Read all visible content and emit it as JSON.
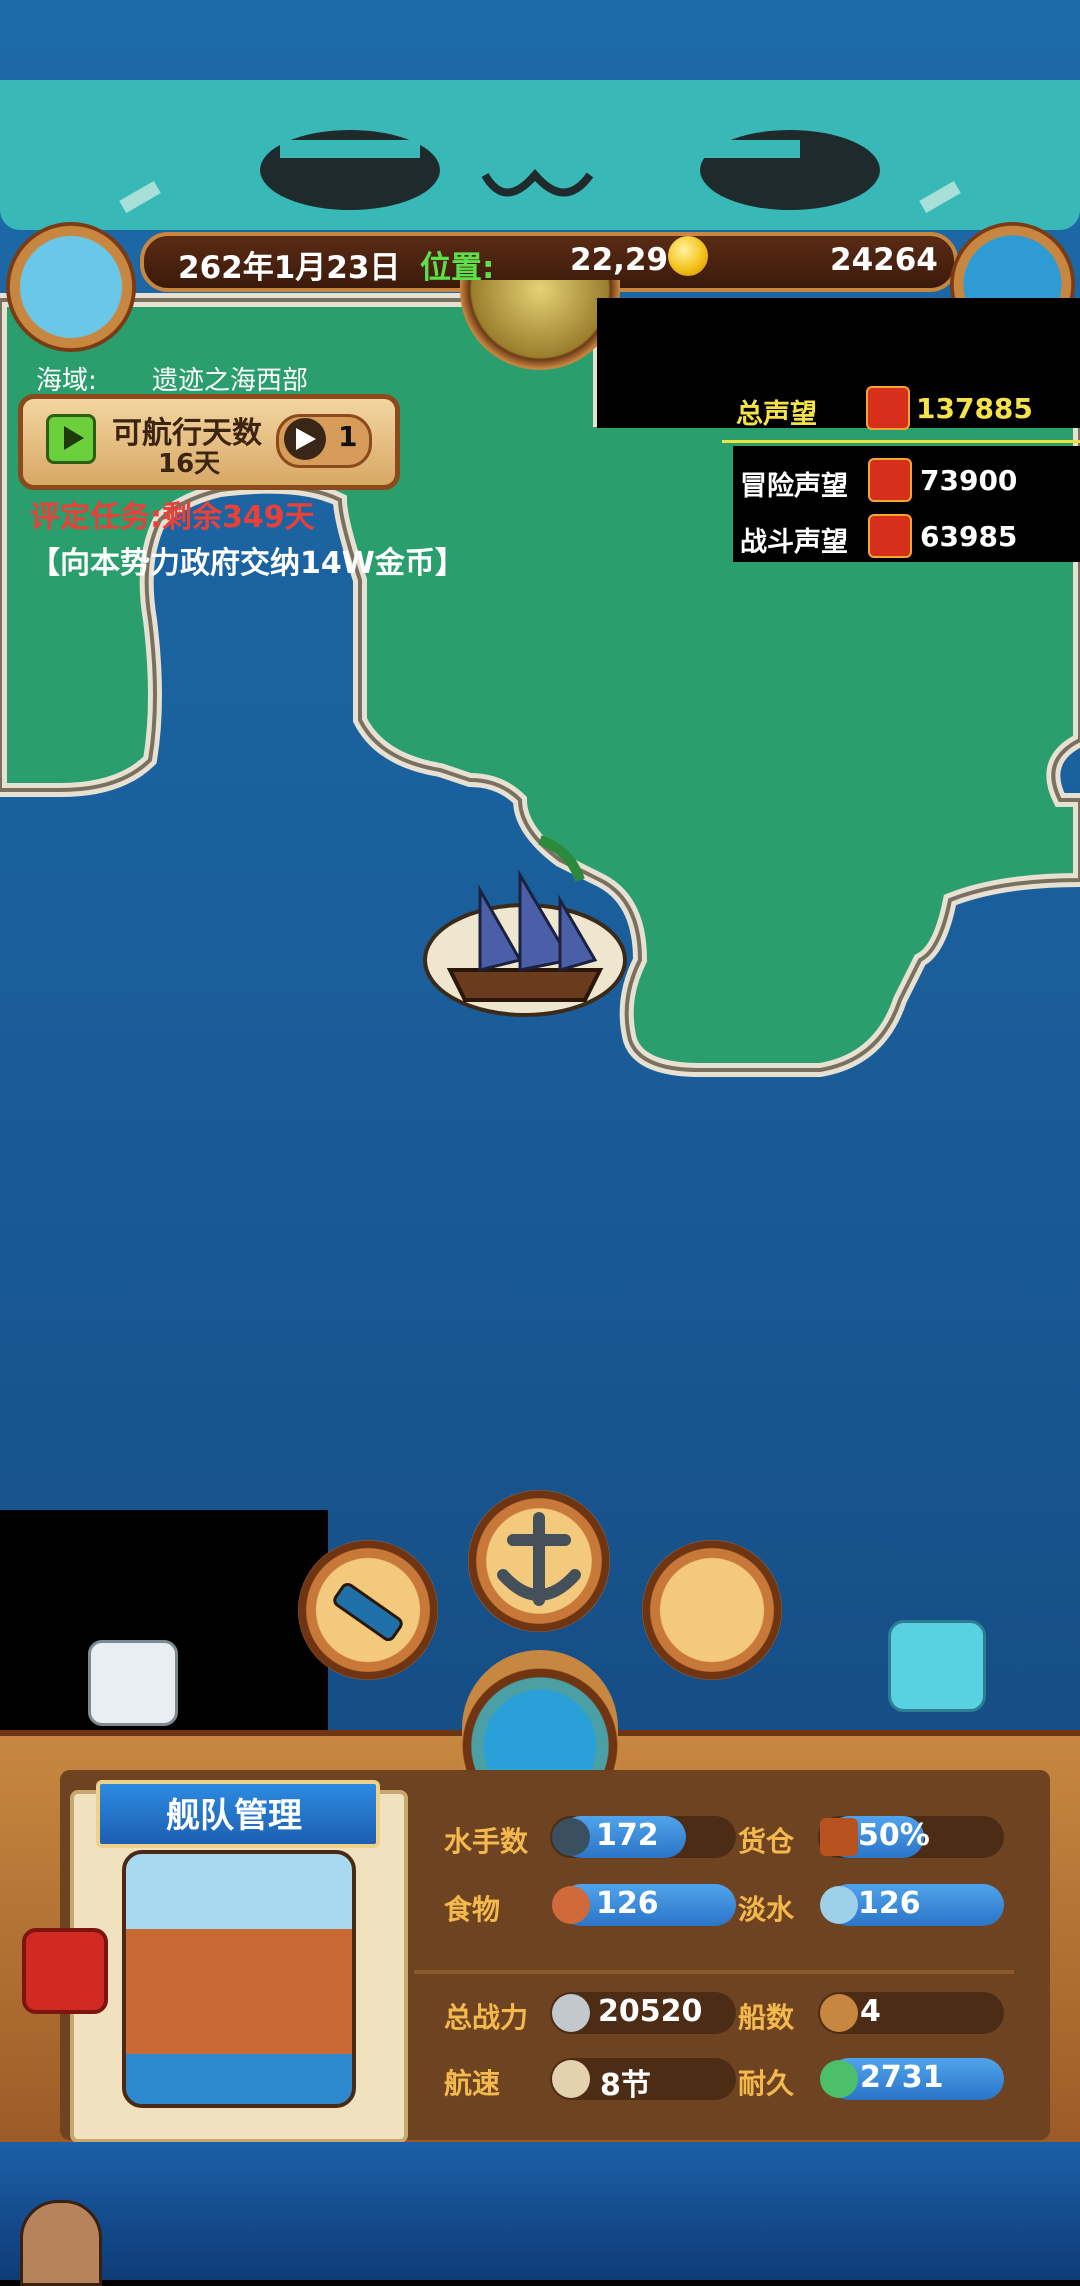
{
  "top_bar": {
    "date": "262年1月23日",
    "position_label": "位置:",
    "position_value": "22,29",
    "gold": "24264"
  },
  "sea_area": {
    "label": "海域:",
    "value": "遗迹之海西部"
  },
  "sail_panel": {
    "title": "可航行天数",
    "days": "16天",
    "compass_count": "1"
  },
  "task": {
    "status": "评定任务:剩余349天",
    "description": "【向本势力政府交纳14W金币】"
  },
  "reputation": {
    "total_label": "总声望",
    "total_value": "137885",
    "adventure_label": "冒险声望",
    "adventure_value": "73900",
    "battle_label": "战斗声望",
    "battle_value": "63985"
  },
  "fleet": {
    "title": "舰队管理",
    "sailors_label": "水手数",
    "sailors_value": "172",
    "cargo_label": "货仓",
    "cargo_value": "50%",
    "food_label": "食物",
    "food_value": "126",
    "water_label": "淡水",
    "water_value": "126",
    "power_label": "总战力",
    "power_value": "20520",
    "ships_label": "船数",
    "ships_value": "4",
    "speed_label": "航速",
    "speed_value": "8节",
    "durability_label": "耐久",
    "durability_value": "2731"
  },
  "colors": {
    "land": "#2a9e6c",
    "sea": "#1a5f9c",
    "accent_gold": "#f5e24a",
    "task_red": "#e8413a",
    "bar_blue": "#3a8be0"
  },
  "icons": [
    "pirate-avatar-icon",
    "treasure-chest-icon",
    "globe-icon",
    "play-icon",
    "compass-icon",
    "spyglass-icon",
    "anchor-icon",
    "world-map-icon",
    "ship-icon",
    "alert-icon"
  ]
}
